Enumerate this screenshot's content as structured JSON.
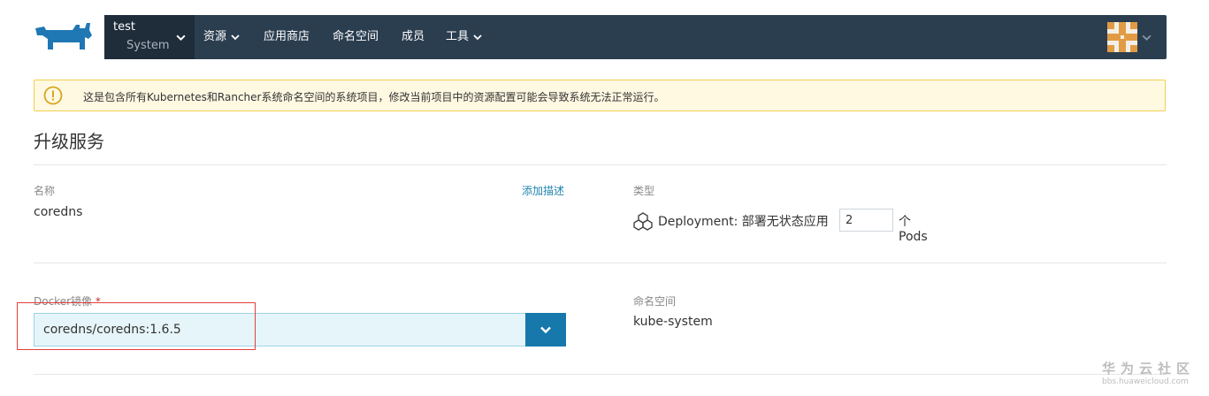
{
  "brand": {
    "logo_icon": "rancher-cow-logo",
    "color": "#1f77b4"
  },
  "header": {
    "cluster": "test",
    "project": "System",
    "nav": [
      {
        "label": "资源",
        "has_dropdown": true
      },
      {
        "label": "应用商店",
        "has_dropdown": false
      },
      {
        "label": "命名空间",
        "has_dropdown": false
      },
      {
        "label": "成员",
        "has_dropdown": false
      },
      {
        "label": "工具",
        "has_dropdown": true
      }
    ],
    "avatar_icon": "user-avatar-icon",
    "bg_color": "#2b3e50"
  },
  "alert": {
    "icon": "warning-circle-icon",
    "text": "这是包含所有Kubernetes和Rancher系统命名空间的系统项目，修改当前项目中的资源配置可能会导致系统无法正常运行。"
  },
  "page": {
    "title": "升级服务"
  },
  "form": {
    "name_label": "名称",
    "name_value": "coredns",
    "add_description": "添加描述",
    "type_label": "类型",
    "type_text": "Deployment: 部署无状态应用",
    "scale_value": "2",
    "scale_unit": "个Pods",
    "image_label": "Docker镜像",
    "image_required_mark": "*",
    "image_value": "coredns/coredns:1.6.5",
    "namespace_label": "命名空间",
    "namespace_value": "kube-system"
  },
  "watermark": {
    "title": "华为云社区",
    "url": "bbs.huaweicloud.com"
  }
}
